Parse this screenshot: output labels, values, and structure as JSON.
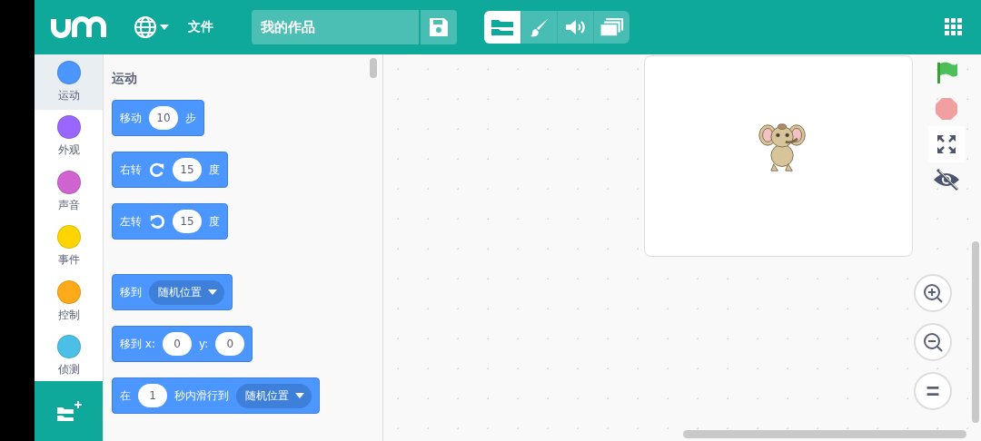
{
  "header": {
    "menu_file": "文件",
    "project_title": "我的作品",
    "tabs": [
      {
        "selected": true
      },
      {
        "selected": false
      },
      {
        "selected": false
      },
      {
        "selected": false
      }
    ]
  },
  "categories": [
    {
      "name": "运动",
      "color": "#4c97ff",
      "selected": true
    },
    {
      "name": "外观",
      "color": "#9966ff",
      "selected": false
    },
    {
      "name": "声音",
      "color": "#cf63cf",
      "selected": false
    },
    {
      "name": "事件",
      "color": "#ffd500",
      "selected": false
    },
    {
      "name": "控制",
      "color": "#ffab19",
      "selected": false
    },
    {
      "name": "侦测",
      "color": "#4cbfe6",
      "selected": false
    }
  ],
  "palette": {
    "title": "运动",
    "groups": [
      {
        "blocks": [
          {
            "parts": [
              {
                "kind": "text",
                "text": "移动"
              },
              {
                "kind": "number",
                "text": "10"
              },
              {
                "kind": "text",
                "text": "步"
              }
            ]
          },
          {
            "parts": [
              {
                "kind": "text",
                "text": "右转"
              },
              {
                "kind": "cw"
              },
              {
                "kind": "number",
                "text": "15"
              },
              {
                "kind": "text",
                "text": "度"
              }
            ]
          },
          {
            "parts": [
              {
                "kind": "text",
                "text": "左转"
              },
              {
                "kind": "ccw"
              },
              {
                "kind": "number",
                "text": "15"
              },
              {
                "kind": "text",
                "text": "度"
              }
            ]
          }
        ]
      },
      {
        "blocks": [
          {
            "parts": [
              {
                "kind": "text",
                "text": "移到"
              },
              {
                "kind": "dropdown",
                "text": "随机位置"
              }
            ]
          },
          {
            "parts": [
              {
                "kind": "text",
                "text": "移到 x:"
              },
              {
                "kind": "number",
                "text": "0"
              },
              {
                "kind": "text",
                "text": "y:"
              },
              {
                "kind": "number",
                "text": "0"
              }
            ]
          },
          {
            "parts": [
              {
                "kind": "text",
                "text": "在"
              },
              {
                "kind": "number",
                "text": "1"
              },
              {
                "kind": "text",
                "text": "秒内滑行到"
              },
              {
                "kind": "dropdown",
                "text": "随机位置"
              }
            ]
          }
        ]
      }
    ]
  }
}
